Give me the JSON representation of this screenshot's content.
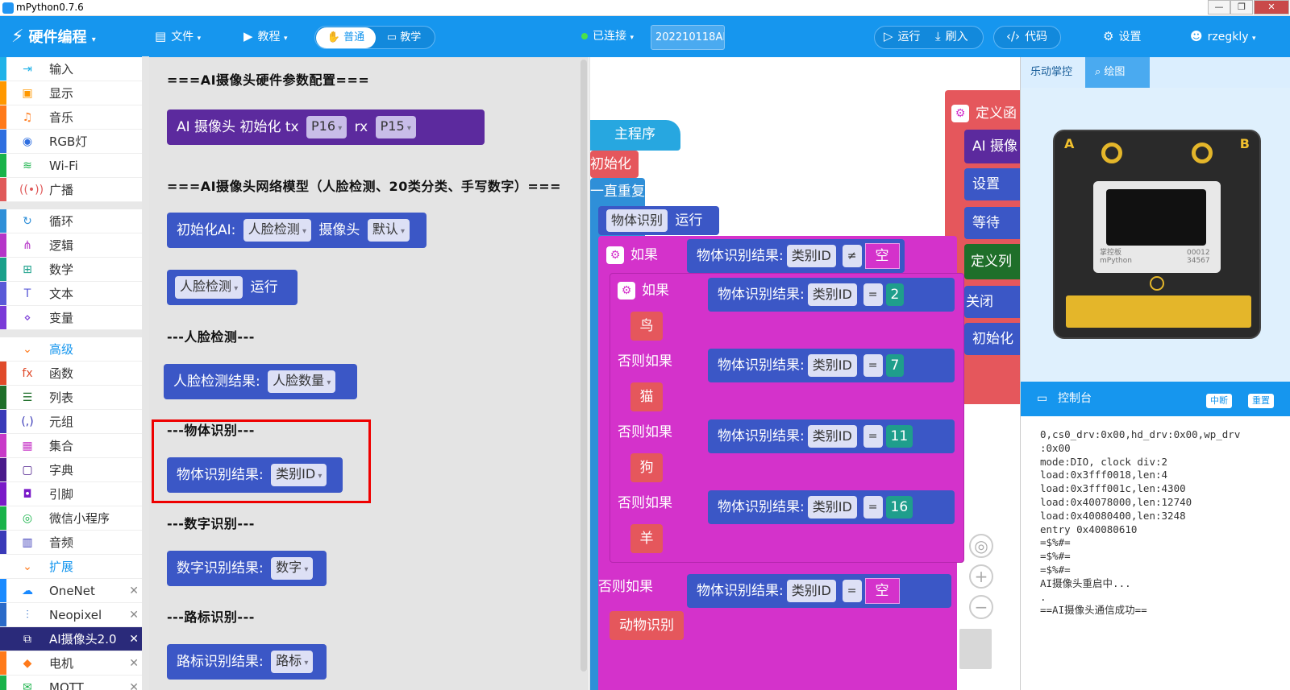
{
  "window": {
    "title": "mPython0.7.6"
  },
  "topbar": {
    "brand": "硬件编程",
    "file": "文件",
    "tutorial": "教程",
    "mode_normal": "普通",
    "mode_teach": "教学",
    "status": "已连接",
    "device": "202210118AI",
    "run": "运行",
    "flash": "刷入",
    "code": "代码",
    "settings": "设置",
    "user": "rzegkly"
  },
  "sidebar": {
    "items": [
      {
        "label": "输入",
        "color": "#20b2e8",
        "icon": "input-icon"
      },
      {
        "label": "显示",
        "color": "#ff9800",
        "icon": "display-icon"
      },
      {
        "label": "音乐",
        "color": "#ff7a1a",
        "icon": "music-icon"
      },
      {
        "label": "RGB灯",
        "color": "#2f6fe0",
        "icon": "bulb-icon"
      },
      {
        "label": "Wi-Fi",
        "color": "#19b34a",
        "icon": "wifi-icon"
      },
      {
        "label": "广播",
        "color": "#e05a5a",
        "icon": "broadcast-icon"
      },
      {
        "label": "循环",
        "color": "#2f8fd8",
        "icon": "loop-icon"
      },
      {
        "label": "逻辑",
        "color": "#b535c8",
        "icon": "logic-icon"
      },
      {
        "label": "数学",
        "color": "#1aa08a",
        "icon": "math-icon"
      },
      {
        "label": "文本",
        "color": "#5a5ad8",
        "icon": "text-icon"
      },
      {
        "label": "变量",
        "color": "#7a3ad8",
        "icon": "variable-icon"
      },
      {
        "label": "高级",
        "color": "#ffffff",
        "icon": "chevron-down-icon"
      },
      {
        "label": "函数",
        "color": "#e04a2a",
        "icon": "function-icon"
      },
      {
        "label": "列表",
        "color": "#1f6f2a",
        "icon": "list-icon"
      },
      {
        "label": "元组",
        "color": "#3a3ab8",
        "icon": "tuple-icon"
      },
      {
        "label": "集合",
        "color": "#c83ac8",
        "icon": "set-icon"
      },
      {
        "label": "字典",
        "color": "#4a1a8a",
        "icon": "dict-icon"
      },
      {
        "label": "引脚",
        "color": "#7a1ac8",
        "icon": "pin-icon"
      },
      {
        "label": "微信小程序",
        "color": "#19b34a",
        "icon": "wechat-icon"
      },
      {
        "label": "音频",
        "color": "#3a3ab8",
        "icon": "audio-icon"
      },
      {
        "label": "扩展",
        "color": "#ffffff",
        "icon": "chevron-down-icon"
      },
      {
        "label": "OneNet",
        "color": "#1a8aff",
        "icon": "cloud-icon"
      },
      {
        "label": "Neopixel",
        "color": "#2a6ac8",
        "icon": "neopixel-icon"
      },
      {
        "label": "AI摄像头2.0",
        "color": "#2a2a7a",
        "icon": "network-icon"
      },
      {
        "label": "电机",
        "color": "#ff7a1a",
        "icon": "motor-icon"
      },
      {
        "label": "MQTT",
        "color": "#19b34a",
        "icon": "mqtt-icon"
      }
    ]
  },
  "flyout": {
    "h1": "===AI摄像头硬件参数配置===",
    "b1": {
      "a": "AI 摄像头 初始化  tx",
      "p1": "P16",
      "rx": "rx",
      "p2": "P15"
    },
    "h2": "===AI摄像头网络模型（人脸检测、20类分类、手写数字）===",
    "b2": {
      "a": "初始化AI:",
      "dd1": "人脸检测",
      "b": "摄像头",
      "dd2": "默认"
    },
    "b3": {
      "dd": "人脸检测",
      "b": "运行"
    },
    "h3": "---人脸检测---",
    "b4": {
      "a": "人脸检测结果:",
      "dd": "人脸数量"
    },
    "h4": "---物体识别---",
    "b5": {
      "a": "物体识别结果:",
      "dd": "类别ID"
    },
    "h5": "---数字识别---",
    "b6": {
      "a": "数字识别结果:",
      "dd": "数字"
    },
    "h6": "---路标识别---",
    "b7": {
      "a": "路标识别结果:",
      "dd": "路标"
    }
  },
  "workspace": {
    "main": "主程序",
    "init": "初始化",
    "loop": "一直重复",
    "run_dd": "物体识别",
    "run": "运行",
    "if": "如果",
    "elif": "否则如果",
    "result": "物体识别结果:",
    "id": "类别ID",
    "neq": "≠",
    "eq": "=",
    "empty": "空",
    "n1": "2",
    "a1": "鸟",
    "n2": "7",
    "a2": "猫",
    "n3": "11",
    "a3": "狗",
    "n4": "16",
    "a4": "羊",
    "a5": "动物识别",
    "right": {
      "def": "定义函",
      "cam": "AI 摄像",
      "set": "设置",
      "wait": "等待",
      "deflist": "定义列",
      "close": "关闭",
      "init": "初始化"
    }
  },
  "right": {
    "tab1": "乐动掌控",
    "tab2": "绘图",
    "console_title": "控制台",
    "btn_break": "中断",
    "btn_reset": "重置",
    "board": {
      "a": "A",
      "b": "B",
      "serial1": "00012",
      "serial2": "34567",
      "brand": "掌控板",
      "brand_en": "mPython"
    },
    "console": [
      "0,cs0_drv:0x00,hd_drv:0x00,wp_drv",
      ":0x00",
      "mode:DIO, clock div:2",
      "load:0x3fff0018,len:4",
      "load:0x3fff001c,len:4300",
      "load:0x40078000,len:12740",
      "load:0x40080400,len:3248",
      "entry 0x40080610",
      "=$%#=",
      "=$%#=",
      "=$%#=",
      "AI摄像头重启中...",
      ".",
      "==AI摄像头通信成功=="
    ]
  }
}
